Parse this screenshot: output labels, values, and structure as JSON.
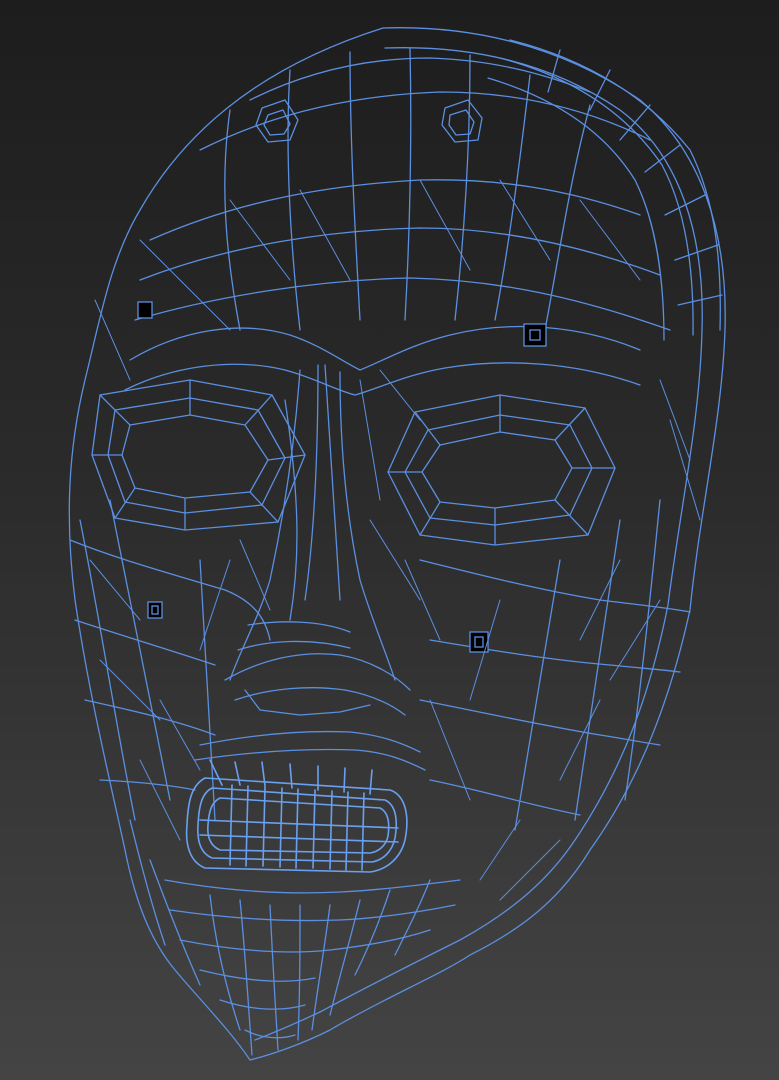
{
  "viewport": {
    "background_top": "#1d1d1d",
    "background_bottom": "#444444"
  },
  "model": {
    "subject": "mask-wireframe",
    "render_mode": "wireframe",
    "wire_color": "#5b8fe0",
    "wire_color_dense": "#6aa0f0"
  }
}
